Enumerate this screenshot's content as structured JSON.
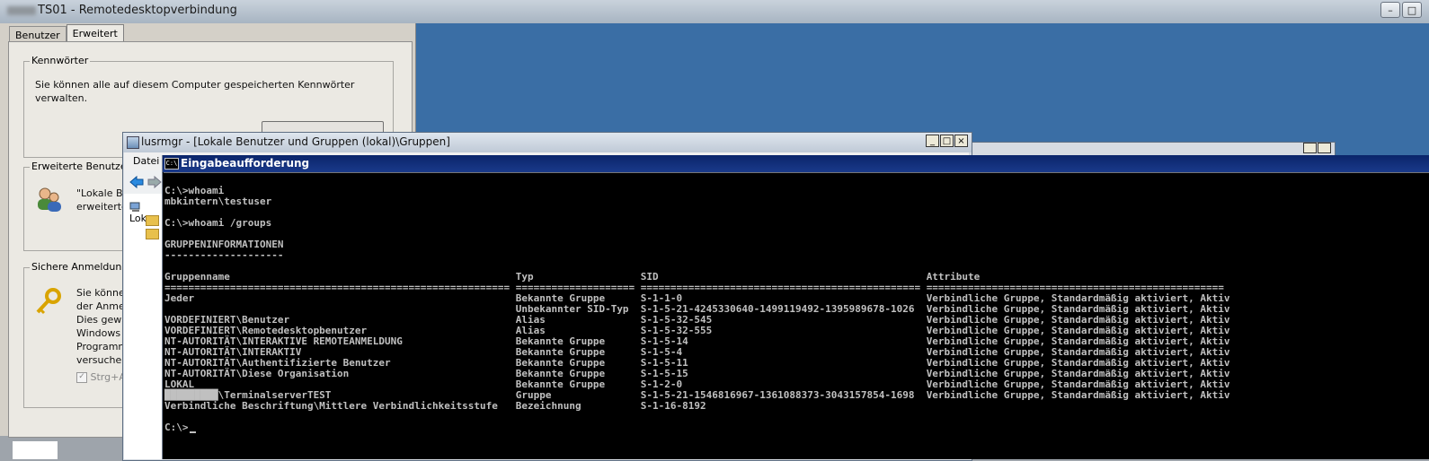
{
  "rdp": {
    "title": "TS01 - Remotedesktopverbindung",
    "min": "–",
    "max": "□"
  },
  "dialog": {
    "tabs": [
      "Benutzer",
      "Erweitert"
    ],
    "kennwoerter": {
      "label": "Kennwörter",
      "text_line1": "Sie können alle auf diesem Computer gespeicherten Kennwörter",
      "text_line2": "verwalten."
    },
    "erweitert": {
      "label": "Erweiterte Benutzer",
      "text_line1": "\"Lokale B",
      "text_line2": "erweiterte"
    },
    "sichere": {
      "label": "Sichere Anmeldung",
      "lines": [
        "Sie könne",
        "der Anme",
        "Dies gewä",
        "Windows",
        "Programn",
        "versucher"
      ],
      "checkbox_label": "Strg+A"
    }
  },
  "lusrmgr": {
    "title": "lusrmgr - [Lokale Benutzer und Gruppen (lokal)\\Gruppen]",
    "menu_datei": "Datei",
    "tree_root": "Loka",
    "min": "_",
    "max": "□",
    "close": "×"
  },
  "cmd": {
    "title": "Eingabeaufforderung",
    "icon_text": "C:\\",
    "lines": [
      "C:\\>whoami",
      "mbkintern\\testuser",
      "",
      "C:\\>whoami /groups",
      "",
      "GRUPPENINFORMATIONEN",
      "--------------------",
      "",
      "Gruppenname                                                Typ                  SID                                             Attribute",
      "========================================================== ==================== =============================================== ==================================================",
      "Jeder                                                      Bekannte Gruppe      S-1-1-0                                         Verbindliche Gruppe, Standardmäßig aktiviert, Aktiv",
      "                                                           Unbekannter SID-Typ  S-1-5-21-4245330640-1499119492-1395989678-1026  Verbindliche Gruppe, Standardmäßig aktiviert, Aktiv",
      "VORDEFINIERT\\Benutzer                                      Alias                S-1-5-32-545                                    Verbindliche Gruppe, Standardmäßig aktiviert, Aktiv",
      "VORDEFINIERT\\Remotedesktopbenutzer                         Alias                S-1-5-32-555                                    Verbindliche Gruppe, Standardmäßig aktiviert, Aktiv",
      "NT-AUTORITÄT\\INTERAKTIVE REMOTEANMELDUNG                   Bekannte Gruppe      S-1-5-14                                        Verbindliche Gruppe, Standardmäßig aktiviert, Aktiv",
      "NT-AUTORITÄT\\INTERAKTIV                                    Bekannte Gruppe      S-1-5-4                                         Verbindliche Gruppe, Standardmäßig aktiviert, Aktiv",
      "NT-AUTORITÄT\\Authentifizierte Benutzer                     Bekannte Gruppe      S-1-5-11                                        Verbindliche Gruppe, Standardmäßig aktiviert, Aktiv",
      "NT-AUTORITÄT\\Diese Organisation                            Bekannte Gruppe      S-1-5-15                                        Verbindliche Gruppe, Standardmäßig aktiviert, Aktiv",
      "LOKAL                                                      Bekannte Gruppe      S-1-2-0                                         Verbindliche Gruppe, Standardmäßig aktiviert, Aktiv",
      "█████████\\TerminalserverTEST                               Gruppe               S-1-5-21-1546816967-1361088373-3043157854-1698  Verbindliche Gruppe, Standardmäßig aktiviert, Aktiv",
      "Verbindliche Beschriftung\\Mittlere Verbindlichkeitsstufe   Bezeichnung          S-1-16-8192",
      "",
      "C:\\>"
    ]
  }
}
